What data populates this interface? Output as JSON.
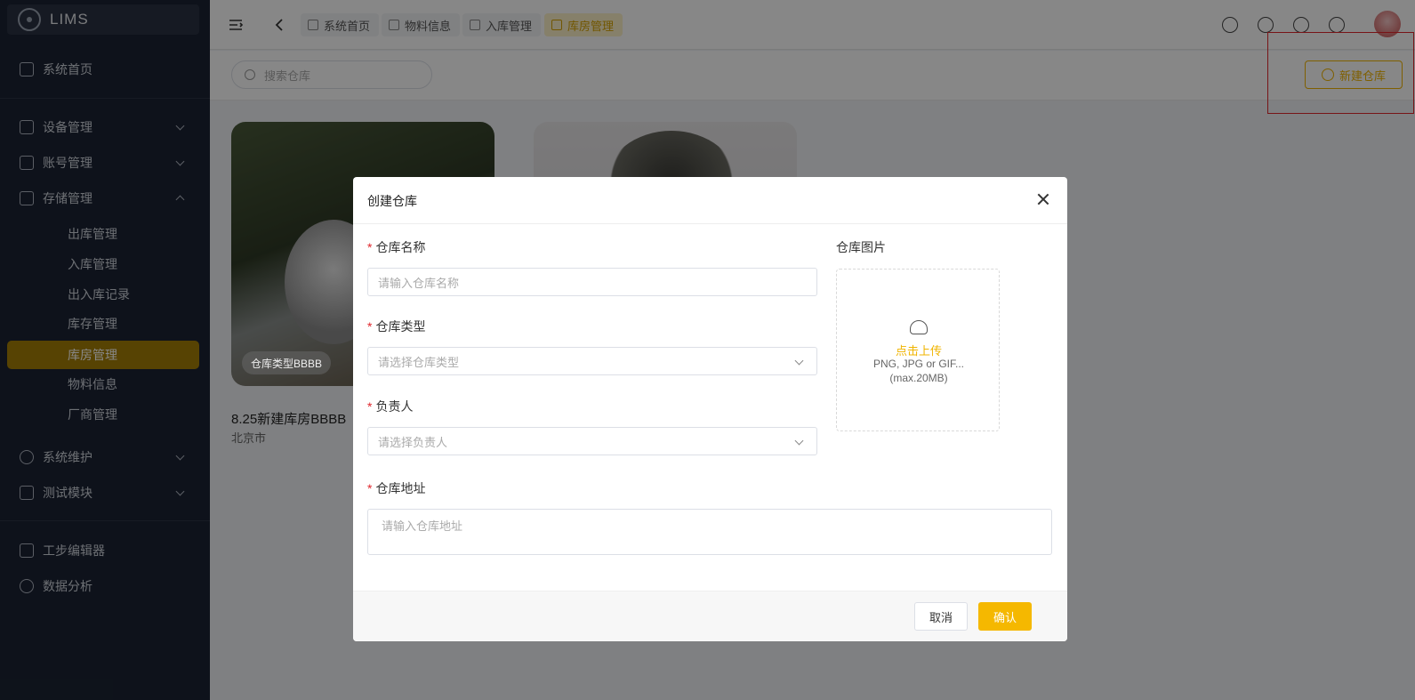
{
  "app": {
    "name": "LIMS"
  },
  "sidebar": {
    "items": [
      {
        "label": "系统首页",
        "icon": "home-icon"
      },
      {
        "label": "设备管理",
        "icon": "list-icon"
      },
      {
        "label": "账号管理",
        "icon": "users-icon"
      },
      {
        "label": "存储管理",
        "icon": "storage-icon"
      },
      {
        "label": "系统维护",
        "icon": "peace-icon"
      },
      {
        "label": "测试模块",
        "icon": "list-icon"
      },
      {
        "label": "工步编辑器",
        "icon": "grid-icon"
      },
      {
        "label": "数据分析",
        "icon": "pie-icon"
      }
    ],
    "storage_sub": [
      "出库管理",
      "入库管理",
      "出入库记录",
      "库存管理",
      "库房管理",
      "物料信息",
      "厂商管理"
    ],
    "active_sub": "库房管理"
  },
  "tabs": [
    {
      "label": "系统首页"
    },
    {
      "label": "物料信息"
    },
    {
      "label": "入库管理"
    },
    {
      "label": "库房管理"
    }
  ],
  "toolbar": {
    "search_placeholder": "搜索仓库",
    "new_button": "新建仓库"
  },
  "cards": [
    {
      "type_badge": "仓库类型BBBB",
      "title": "8.25新建库房BBBB",
      "subtitle": "北京市"
    }
  ],
  "modal": {
    "title": "创建仓库",
    "fields": {
      "name_label": "仓库名称",
      "name_placeholder": "请输入仓库名称",
      "type_label": "仓库类型",
      "type_placeholder": "请选择仓库类型",
      "owner_label": "负责人",
      "owner_placeholder": "请选择负责人",
      "address_label": "仓库地址",
      "address_placeholder": "请输入仓库地址",
      "image_label": "仓库图片"
    },
    "upload": {
      "main": "点击上传",
      "hint": "PNG, JPG or GIF...",
      "max": "(max.20MB)"
    },
    "cancel": "取消",
    "confirm": "确认"
  },
  "colors": {
    "accent": "#f5b800",
    "sidebar_bg": "#1b2333",
    "active_sub_bg": "#a57f06"
  }
}
